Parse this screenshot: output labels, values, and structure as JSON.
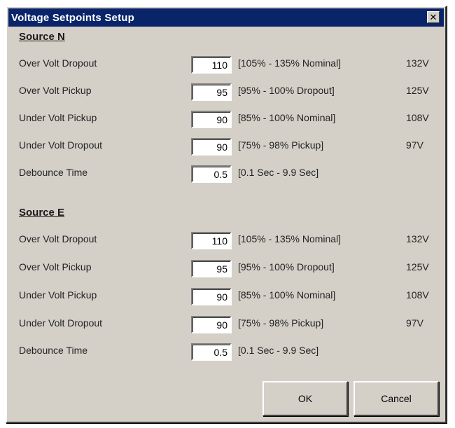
{
  "window": {
    "title": "Voltage Setpoints Setup",
    "close_glyph": "✕"
  },
  "sections": [
    {
      "heading": "Source N",
      "rows": [
        {
          "label": "Over Volt Dropout",
          "value": "110",
          "range": "[105% - 135% Nominal]",
          "volts": "132V"
        },
        {
          "label": "Over Volt Pickup",
          "value": "95",
          "range": "[95% - 100% Dropout]",
          "volts": "125V"
        },
        {
          "label": "Under Volt Pickup",
          "value": "90",
          "range": "[85% - 100% Nominal]",
          "volts": "108V"
        },
        {
          "label": "Under Volt Dropout",
          "value": "90",
          "range": "[75% - 98% Pickup]",
          "volts": "97V"
        },
        {
          "label": "Debounce Time",
          "value": "0.5",
          "range": "[0.1 Sec - 9.9 Sec]",
          "volts": ""
        }
      ]
    },
    {
      "heading": "Source E",
      "rows": [
        {
          "label": "Over Volt Dropout",
          "value": "110",
          "range": "[105% - 135% Nominal]",
          "volts": "132V"
        },
        {
          "label": "Over Volt Pickup",
          "value": "95",
          "range": "[95% - 100% Dropout]",
          "volts": "125V"
        },
        {
          "label": "Under Volt Pickup",
          "value": "90",
          "range": "[85% - 100% Nominal]",
          "volts": "108V"
        },
        {
          "label": "Under Volt Dropout",
          "value": "90",
          "range": "[75% - 98% Pickup]",
          "volts": "97V"
        },
        {
          "label": "Debounce Time",
          "value": "0.5",
          "range": "[0.1 Sec - 9.9 Sec]",
          "volts": ""
        }
      ]
    }
  ],
  "buttons": {
    "ok_label": "OK",
    "cancel_label": "Cancel"
  }
}
